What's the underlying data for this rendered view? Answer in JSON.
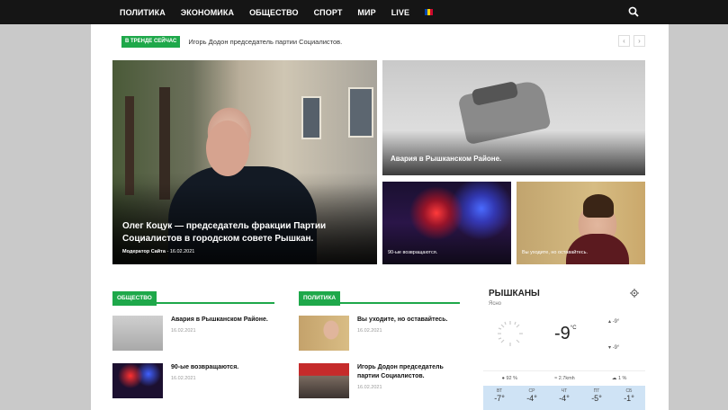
{
  "nav": {
    "items": [
      "ПОЛИТИКА",
      "ЭКОНОМИКА",
      "ОБЩЕСТВО",
      "СПОРТ",
      "МИР",
      "LIVE"
    ],
    "flag_colors": [
      "#0046ae",
      "#ffd200",
      "#cc092f"
    ]
  },
  "trend": {
    "badge": "В ТРЕНДЕ СЕЙЧАС",
    "text": "Игорь Додон председатель партии Социалистов.",
    "prev": "‹",
    "next": "›"
  },
  "hero": {
    "main": {
      "title": "Олег Коцук — председатель фракции Партии Социалистов в городском совете Рышкан.",
      "author": "Модератор Сайта",
      "date": "16.02.2021"
    },
    "crash": {
      "title": "Авария в Рышканском Районе."
    },
    "police": {
      "title": "90-ые возвращаются."
    },
    "woman": {
      "title": "Вы уходите, но оставайтесь."
    }
  },
  "sections": {
    "society": {
      "label": "ОБЩЕСТВО",
      "items": [
        {
          "title": "Авария в Рышканском Районе.",
          "date": "16.02.2021"
        },
        {
          "title": "90-ые возвращаются.",
          "date": "16.02.2021"
        }
      ]
    },
    "politics": {
      "label": "ПОЛИТИКА",
      "items": [
        {
          "title": "Вы уходите, но оставайтесь.",
          "date": "16.02.2021"
        },
        {
          "title": "Игорь Додон председатель партии Социалистов.",
          "date": "16.02.2021"
        }
      ]
    }
  },
  "weather": {
    "city": "РЫШКАНЫ",
    "condition": "Ясно",
    "temp": "-9",
    "unit": "°C",
    "high": "-9°",
    "low": "-9°",
    "humidity": "92 %",
    "wind": "2.7kmh",
    "clouds": "1 %",
    "forecast": [
      {
        "day": "ВТ",
        "temp": "-7°"
      },
      {
        "day": "СР",
        "temp": "-4°"
      },
      {
        "day": "ЧТ",
        "temp": "-4°"
      },
      {
        "day": "ПТ",
        "temp": "-5°"
      },
      {
        "day": "СБ",
        "temp": "-1°"
      }
    ]
  }
}
